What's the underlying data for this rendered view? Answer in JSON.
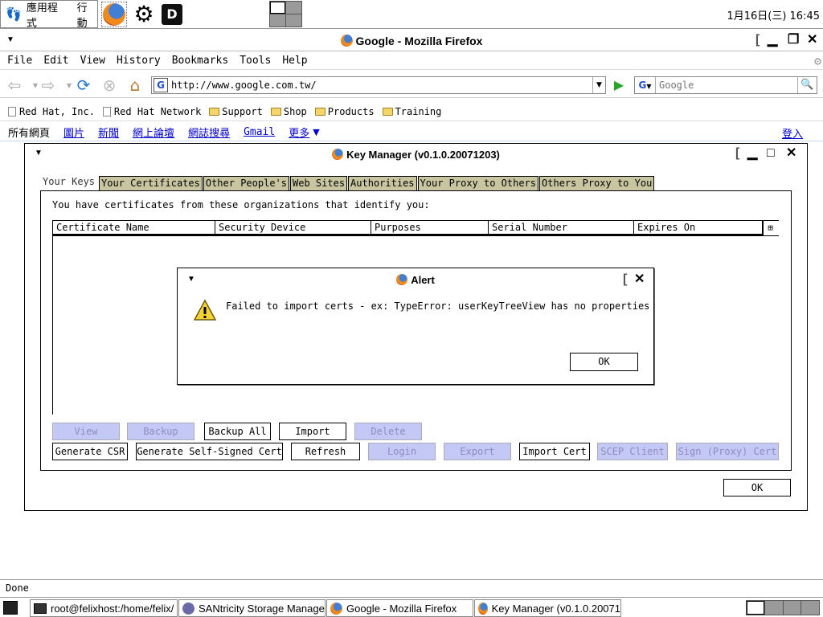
{
  "top_panel": {
    "applications_label": "應用程式",
    "actions_label": "行動",
    "clock": "1月16日(三) 16:45"
  },
  "firefox": {
    "title": "Google - Mozilla Firefox",
    "menu": {
      "file": "File",
      "edit": "Edit",
      "view": "View",
      "history": "History",
      "bookmarks": "Bookmarks",
      "tools": "Tools",
      "help": "Help"
    },
    "url": "http://www.google.com.tw/",
    "search_placeholder": "Google",
    "bookmarks": [
      {
        "label": "Red Hat, Inc.",
        "icon": "page-icon"
      },
      {
        "label": "Red Hat Network",
        "icon": "page-icon"
      },
      {
        "label": "Support",
        "icon": "folder-icon"
      },
      {
        "label": "Shop",
        "icon": "folder-icon"
      },
      {
        "label": "Products",
        "icon": "folder-icon"
      },
      {
        "label": "Training",
        "icon": "folder-icon"
      }
    ],
    "google_bar": {
      "current": "所有網頁",
      "links": [
        "圖片",
        "新聞",
        "網上論壇",
        "網誌搜尋",
        "Gmail"
      ],
      "more": "更多",
      "login": "登入"
    },
    "status": "Done"
  },
  "key_manager": {
    "title": "Key Manager (v0.1.0.20071203)",
    "tabs": [
      "Your Keys",
      "Your Certificates",
      "Other People's",
      "Web Sites",
      "Authorities",
      "Your Proxy to Others",
      "Others Proxy to You"
    ],
    "description": "You have certificates from these organizations that identify you:",
    "columns": [
      "Certificate Name",
      "Security Device",
      "Purposes",
      "Serial Number",
      "Expires On"
    ],
    "buttons_row1": {
      "view": "View",
      "backup": "Backup",
      "backup_all": "Backup All",
      "import": "Import",
      "delete": "Delete"
    },
    "buttons_row2": {
      "generate_csr": "Generate CSR",
      "generate_self_signed": "Generate Self-Signed Cert",
      "refresh": "Refresh",
      "login": "Login",
      "export": "Export",
      "import_cert": "Import Cert",
      "scep_client": "SCEP Client",
      "sign_proxy_cert": "Sign (Proxy) Cert"
    },
    "ok": "OK"
  },
  "alert": {
    "title": "Alert",
    "message": "Failed to import certs - ex: TypeError: userKeyTreeView has no properties",
    "ok": "OK"
  },
  "taskbar": [
    "root@felixhost:/home/felix/",
    "SANtricity Storage Manage",
    "Google - Mozilla Firefox",
    "Key Manager (v0.1.0.20071"
  ],
  "colors": {
    "tab_inactive": "#c8c6a0",
    "disabled_button": "#c4c8f4",
    "link": "#0000cc"
  }
}
